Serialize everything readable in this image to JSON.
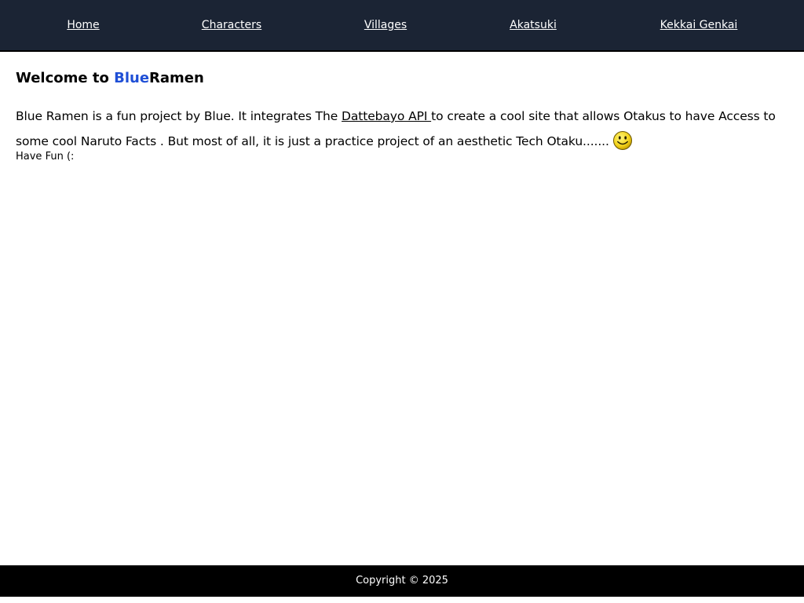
{
  "nav": {
    "items": [
      {
        "label": "Home"
      },
      {
        "label": "Characters"
      },
      {
        "label": "Villages"
      },
      {
        "label": "Akatsuki"
      },
      {
        "label": "Kekkai Genkai"
      }
    ]
  },
  "main": {
    "welcome_prefix": "Welcome to ",
    "brand_highlight": "Blue",
    "brand_rest": "Ramen",
    "intro_part1": "Blue Ramen is a fun project by Blue. It integrates The ",
    "api_link": "Dattebayo API ",
    "intro_part2": "to create a cool site that allows Otakus to have Access to some cool Naruto Facts . But most of all, it is just a practice project of an aesthetic Tech Otaku.......",
    "have_fun": "Have Fun (:"
  },
  "footer": {
    "copyright": "Copyright © 2025"
  },
  "icons": {
    "emoji": "smiley-face-icon"
  },
  "colors": {
    "navbar_bg": "#1b2434",
    "brand_blue": "#1f4fd6",
    "footer_bg": "#000000"
  }
}
